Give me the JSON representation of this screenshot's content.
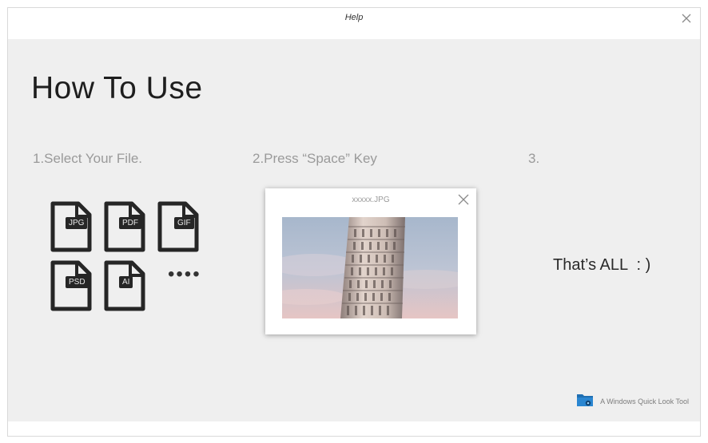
{
  "window": {
    "title": "Help"
  },
  "main": {
    "heading": "How To Use",
    "steps": [
      {
        "label": "1.Select Your File."
      },
      {
        "label": "2.Press “Space” Key"
      },
      {
        "label": "3."
      }
    ],
    "file_types": [
      "JPG",
      "PDF",
      "GIF",
      "PSD",
      "AI"
    ],
    "more_indicator": "••••",
    "preview": {
      "filename": "xxxxx.JPG"
    },
    "final_message": "That’s ALL   : )"
  },
  "footer": {
    "brand_text": "A Windows Quick Look Tool"
  },
  "colors": {
    "background": "#efefef",
    "icon_dark": "#262626",
    "brand_blue": "#1f6fb2"
  }
}
